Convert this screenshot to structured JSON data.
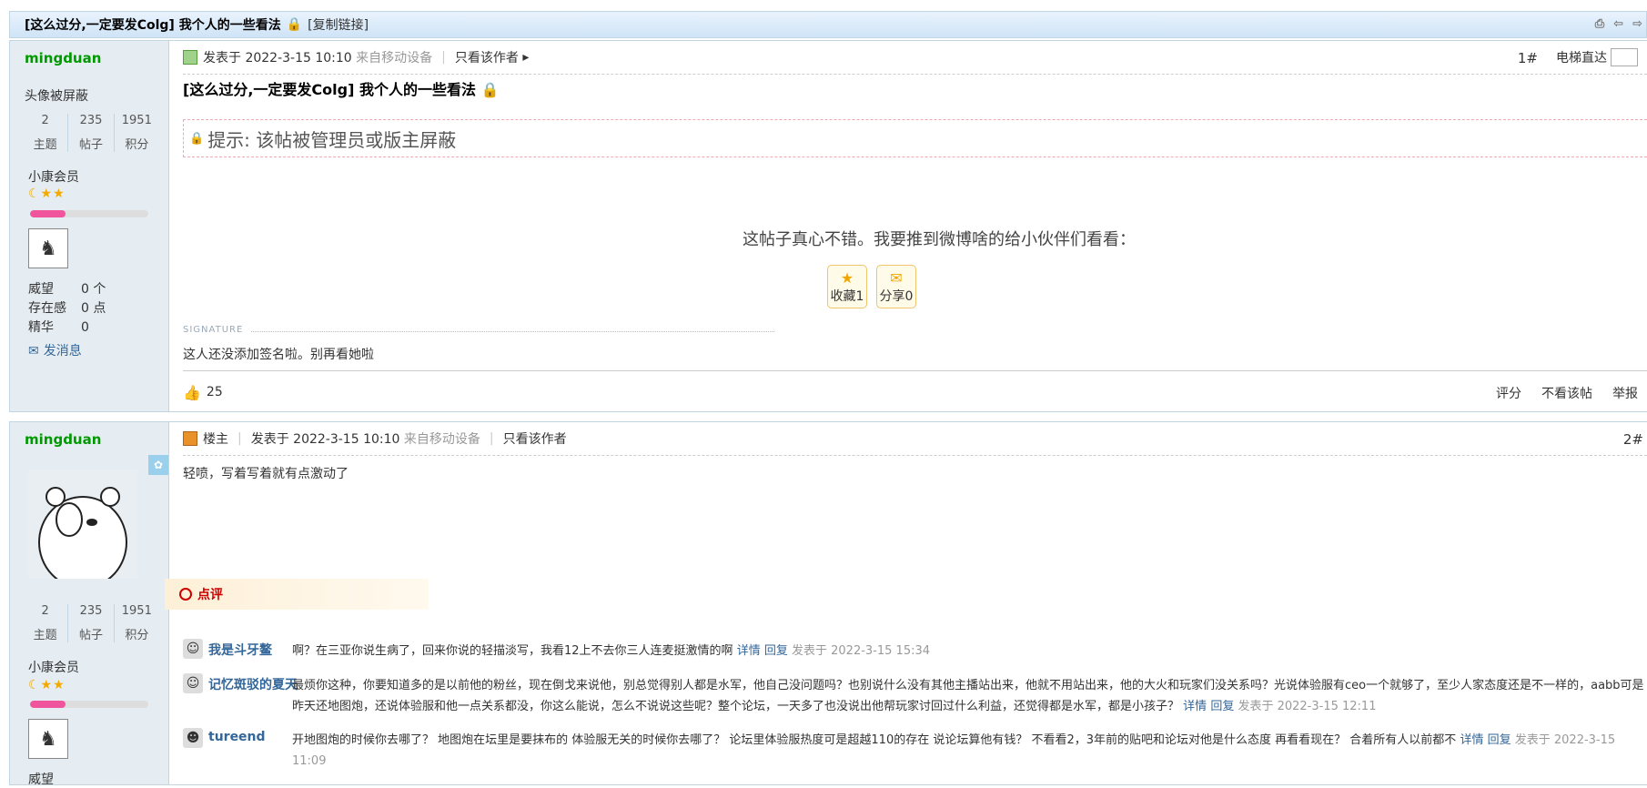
{
  "thread": {
    "title": "[这么过分,一定要发Colg] 我个人的一些看法",
    "copy_link": "[复制链接]"
  },
  "post1": {
    "author": "mingduan",
    "avatar_hidden": "头像被屏蔽",
    "stats": [
      {
        "num": "2",
        "label": "主题"
      },
      {
        "num": "235",
        "label": "帖子"
      },
      {
        "num": "1951",
        "label": "积分"
      }
    ],
    "rank": "小康会员",
    "progress": 0.3,
    "info": [
      {
        "k": "威望",
        "v": "0 个"
      },
      {
        "k": "存在感",
        "v": "0 点"
      },
      {
        "k": "精华",
        "v": "0"
      }
    ],
    "send_msg": "发消息",
    "posted_at": "发表于 2022-3-15 10:10",
    "from_mobile": "来自移动设备",
    "only_author": "只看该作者",
    "floor": "1#",
    "elevator": "电梯直达",
    "title": "[这么过分,一定要发Colg] 我个人的一些看法",
    "notice": "提示: 该帖被管理员或版主屏蔽",
    "share_prompt": "这帖子真心不错。我要推到微博啥的给小伙伴们看看：",
    "fav_btn": "收藏1",
    "share_btn": "分享0",
    "signature_label": "SIGNATURE",
    "signature": "这人还没添加签名啦。别再看她啦",
    "likes": "25",
    "actions": [
      "评分",
      "不看该帖",
      "举报"
    ]
  },
  "post2": {
    "author": "mingduan",
    "stats": [
      {
        "num": "2",
        "label": "主题"
      },
      {
        "num": "235",
        "label": "帖子"
      },
      {
        "num": "1951",
        "label": "积分"
      }
    ],
    "rank": "小康会员",
    "progress": 0.3,
    "owner": "楼主",
    "posted_at": "发表于 2022-3-15 10:10",
    "from_mobile": "来自移动设备",
    "only_author": "只看该作者",
    "floor": "2#",
    "body": "轻喷，写着写着就有点激动了",
    "comment_tab": "点评",
    "comments": [
      {
        "name": "我是斗牙鳌",
        "text": "啊？在三亚你说生病了，回来你说的轻描淡写，我看12上不去你三人连麦挺激情的啊",
        "detail": "详情",
        "reply": "回复",
        "time": "发表于 2022-3-15 15:34"
      },
      {
        "name": "记忆斑驳的夏天",
        "text": "最烦你这种，你要知道多的是以前他的粉丝，现在倒戈来说他，别总觉得别人都是水军，他自己没问题吗？也别说什么没有其他主播站出来，他就不用站出来，他的大火和玩家们没关系吗？光说体验服有ceo一个就够了，至少人家态度还是不一样的，aabb可是昨天还地图炮，还说体验服和他一点关系都没，你这么能说，怎么不说说这些呢？整个论坛，一天多了也没说出他帮玩家讨回过什么利益，还觉得都是水军，都是小孩子？",
        "detail": "详情",
        "reply": "回复",
        "time": "发表于 2022-3-15 12:11"
      },
      {
        "name": "tureend",
        "text": "开地图炮的时候你去哪了？ 地图炮在坛里是要抹布的 体验服无关的时候你去哪了？ 论坛里体验服热度可是超越110的存在 说论坛算他有钱？ 不看看2，3年前的贴吧和论坛对他是什么态度 再看看现在？ 合着所有人以前都不",
        "detail": "详情",
        "reply": "回复",
        "time": "发表于 2022-3-15 11:09"
      }
    ],
    "info_partial": "威望"
  },
  "colors": {
    "author": "#009900",
    "link": "#336699",
    "border": "#c2d5e3",
    "side_bg": "#e5edf2",
    "progress": "#f0549c"
  }
}
